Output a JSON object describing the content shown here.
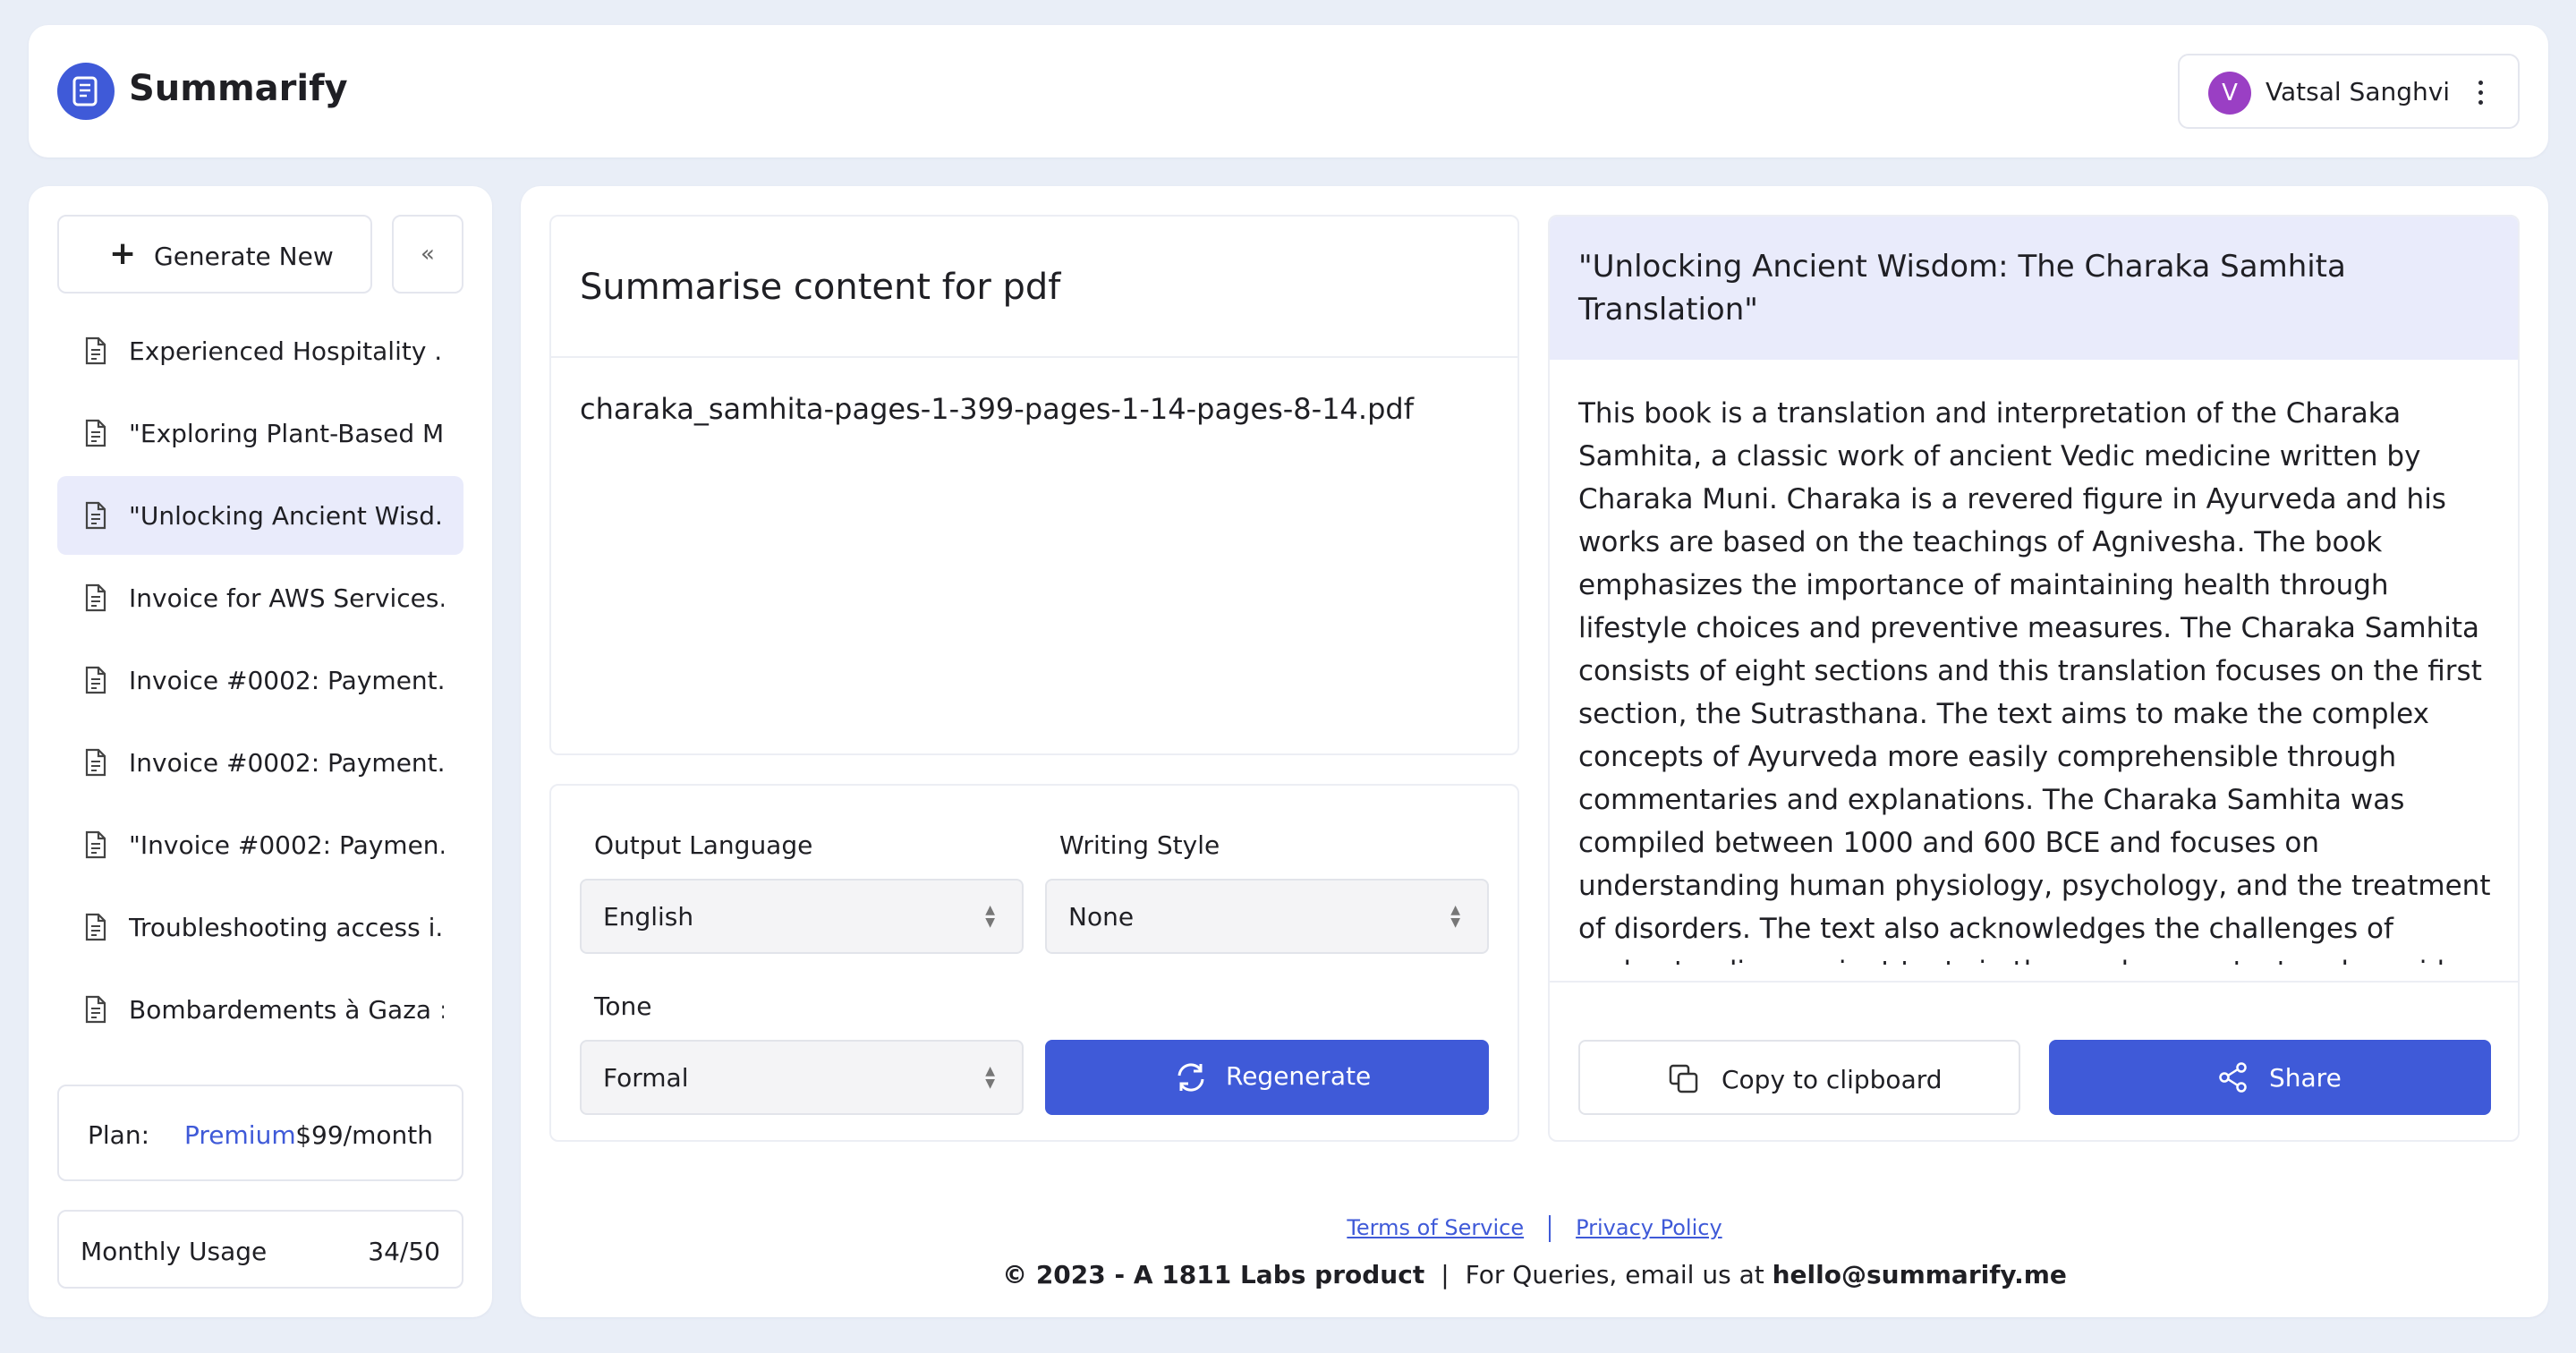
{
  "header": {
    "app_title": "Summarify",
    "user_initial": "V",
    "user_name": "Vatsal Sanghvi"
  },
  "sidebar": {
    "generate_label": "Generate New",
    "collapse_label": "«",
    "items": [
      {
        "label": "Experienced Hospitality ..."
      },
      {
        "label": "\"Exploring Plant-Based M..."
      },
      {
        "label": "\"Unlocking Ancient Wisd..."
      },
      {
        "label": "Invoice for AWS Services..."
      },
      {
        "label": "Invoice #0002: Payment..."
      },
      {
        "label": "Invoice #0002: Payment..."
      },
      {
        "label": "\"Invoice #0002: Paymen..."
      },
      {
        "label": "Troubleshooting access i..."
      },
      {
        "label": "Bombardements à Gaza :..."
      }
    ],
    "active_index": 2,
    "plan": {
      "label": "Plan:",
      "value": "Premium",
      "price": "$99/month"
    },
    "usage": {
      "label": "Monthly Usage",
      "value": "34/50"
    }
  },
  "input_panel": {
    "title": "Summarise content for pdf",
    "filename": "charaka_samhita-pages-1-399-pages-1-14-pages-8-14.pdf"
  },
  "options": {
    "output_language": {
      "label": "Output Language",
      "value": "English"
    },
    "writing_style": {
      "label": "Writing Style",
      "value": "None"
    },
    "tone": {
      "label": "Tone",
      "value": "Formal"
    },
    "regenerate_label": "Regenerate"
  },
  "output": {
    "title": "\"Unlocking Ancient Wisdom: The Charaka Samhita Translation\"",
    "summary": "This book is a translation and interpretation of the Charaka Samhita, a classic work of ancient Vedic medicine written by Charaka Muni. Charaka is a revered figure in Ayurveda and his works are based on the teachings of Agnivesha. The book emphasizes the importance of maintaining health through lifestyle choices and preventive measures. The Charaka Samhita consists of eight sections and this translation focuses on the first section, the Sutrasthana. The text aims to make the complex concepts of Ayurveda more easily comprehensible through commentaries and explanations. The Charaka Samhita was compiled between 1000 and 600 BCE and focuses on understanding human physiology, psychology, and the treatment of disorders. The text also acknowledges the challenges of understanding ancient texts in the modern context and provides examples and explanations to aid comprehension. The overall goal of the book is to create a literal translation of each sutra into all",
    "copy_label": "Copy to clipboard",
    "share_label": "Share"
  },
  "footer": {
    "terms": "Terms of Service",
    "privacy": "Privacy Policy",
    "copyright": "© 2023 - A 1811 Labs product",
    "queries": "For Queries, email us at",
    "email": "hello@summarify.me"
  },
  "colors": {
    "accent": "#3f5ad8",
    "active_bg": "#e9ebfb",
    "avatar": "#9a3fc4"
  }
}
